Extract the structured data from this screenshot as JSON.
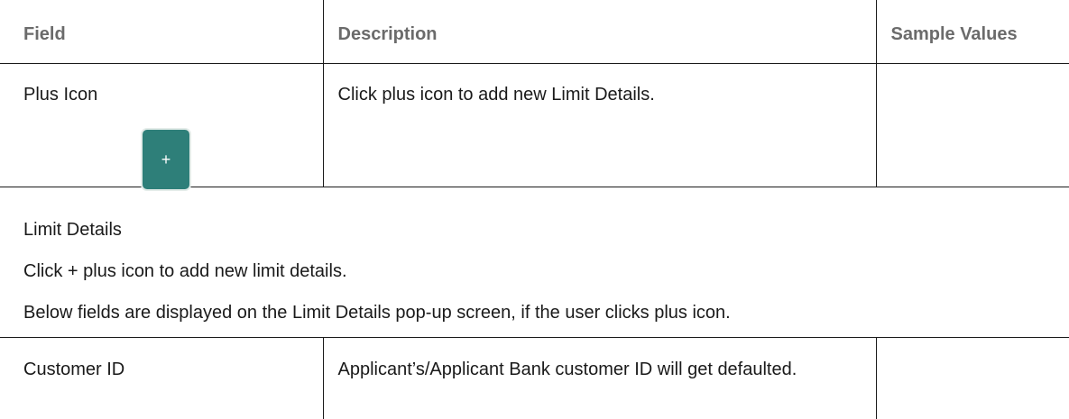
{
  "top_table": {
    "headers": [
      "Field",
      "Description",
      "Sample Values"
    ],
    "row": {
      "field": "Plus Icon",
      "description": "Click plus icon to add new Limit Details.",
      "sample": ""
    },
    "plus_button_glyph": "+"
  },
  "paragraphs": {
    "section_title": "Limit Details",
    "instruction": "Click + plus icon to add new limit details.",
    "note": "Below fields are displayed on the Limit Details pop-up screen, if the user clicks plus icon."
  },
  "bottom_table": {
    "row": {
      "field": "Customer ID",
      "description": "Applicant’s/Applicant Bank customer ID will get defaulted.",
      "sample": ""
    }
  },
  "colors": {
    "button": "#2e7f79",
    "header_text": "#6b6b6b",
    "body_text": "#1a1a1a"
  }
}
